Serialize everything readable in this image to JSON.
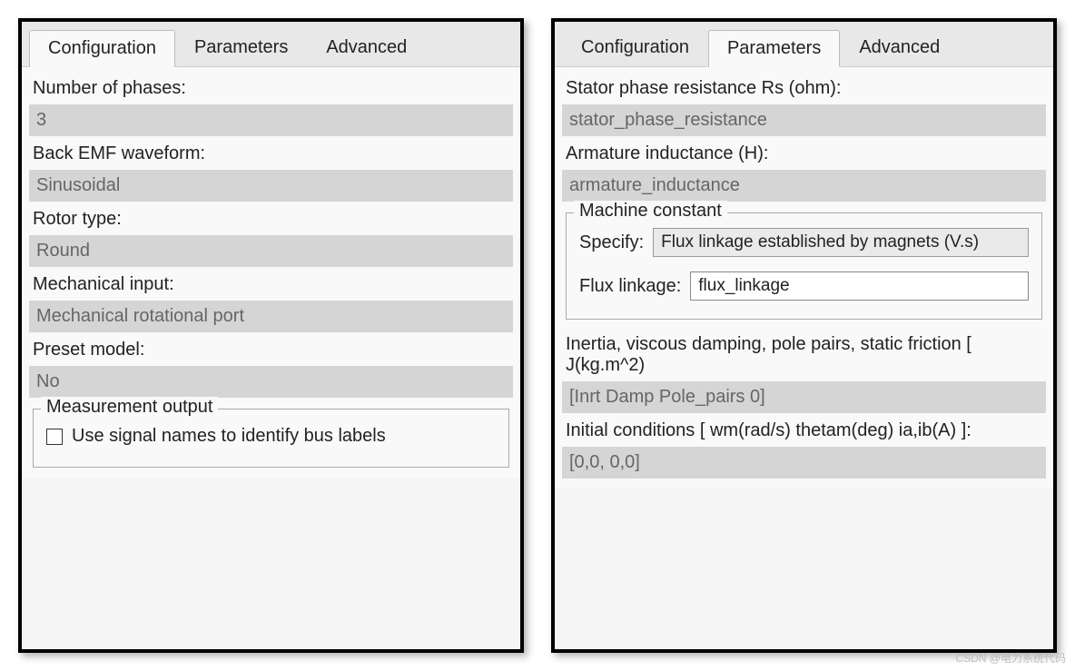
{
  "left_panel": {
    "tabs": {
      "configuration": "Configuration",
      "parameters": "Parameters",
      "advanced": "Advanced"
    },
    "fields": {
      "num_phases_label": "Number of phases:",
      "num_phases_value": "3",
      "back_emf_label": "Back EMF waveform:",
      "back_emf_value": "Sinusoidal",
      "rotor_type_label": "Rotor type:",
      "rotor_type_value": "Round",
      "mech_input_label": "Mechanical input:",
      "mech_input_value": "Mechanical rotational port",
      "preset_model_label": "Preset model:",
      "preset_model_value": "No"
    },
    "measurement_group": {
      "title": "Measurement output",
      "checkbox_label": "Use signal names to identify bus labels"
    }
  },
  "right_panel": {
    "tabs": {
      "configuration": "Configuration",
      "parameters": "Parameters",
      "advanced": "Advanced"
    },
    "fields": {
      "stator_label": "Stator phase resistance Rs (ohm):",
      "stator_value": "stator_phase_resistance",
      "armature_label": "Armature inductance (H):",
      "armature_value": "armature_inductance",
      "inertia_label": "Inertia, viscous damping, pole pairs, static friction [ J(kg.m^2)",
      "inertia_value": "[Inrt Damp Pole_pairs 0]",
      "initial_label": "Initial conditions  [ wm(rad/s)  thetam(deg)  ia,ib(A) ]:",
      "initial_value": "[0,0, 0,0]"
    },
    "machine_constant": {
      "title": "Machine constant",
      "specify_label": "Specify:",
      "specify_value": "Flux linkage established by magnets (V.s)",
      "flux_label": "Flux linkage:",
      "flux_value": "flux_linkage"
    }
  },
  "watermark": "CSDN @电力系统代码"
}
